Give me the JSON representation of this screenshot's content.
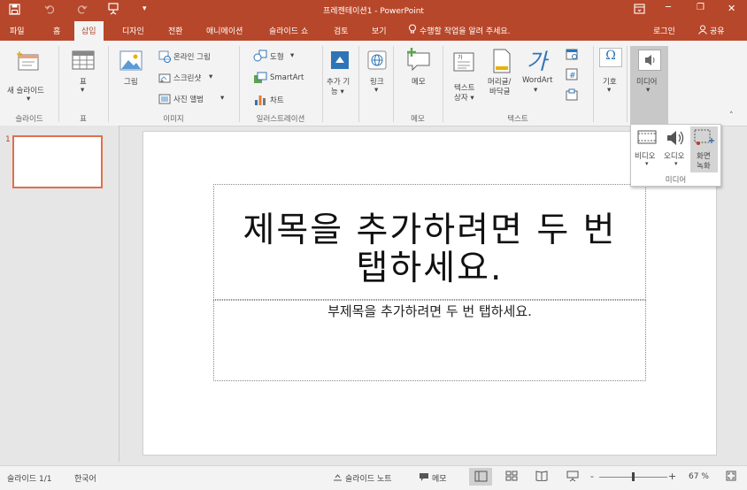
{
  "window": {
    "title": "프레젠테이션1 - PowerPoint",
    "qat": {
      "save_icon": "save-icon",
      "undo_icon": "undo-icon",
      "redo_icon": "redo-icon",
      "start_icon": "slideshow-start-icon",
      "customize": "▾"
    },
    "controls": {
      "ribbon_options": "ribbon-display-icon",
      "minimize": "─",
      "maximize": "❐",
      "close": "✕"
    }
  },
  "tabs": {
    "file": "파일",
    "home": "홈",
    "insert": "삽입",
    "design": "디자인",
    "transitions": "전환",
    "animations": "애니메이션",
    "slideshow": "슬라이드 쇼",
    "review": "검토",
    "view": "보기",
    "tellme": "수행할 작업을 알려 주세요.",
    "signin": "로그인",
    "share": "공유"
  },
  "ribbon": {
    "slides": {
      "new_slide_line1": "새 슬라이드",
      "group": "슬라이드"
    },
    "tables": {
      "table": "표",
      "group": "표"
    },
    "images": {
      "pictures": "그림",
      "online_pictures": "온라인 그림",
      "screenshot": "스크린샷",
      "photo_album": "사진 앨범",
      "group": "이미지"
    },
    "illustrations": {
      "shapes": "도형",
      "smartart": "SmartArt",
      "chart": "차트",
      "group": "일러스트레이션"
    },
    "addins": {
      "line1": "추가 기",
      "line2": "능"
    },
    "links": {
      "link": "링크"
    },
    "comments": {
      "comment": "메모",
      "group": "메모"
    },
    "text": {
      "textbox_line1": "텍스트",
      "textbox_line2": "상자",
      "headerfooter_line1": "머리글/",
      "headerfooter_line2": "바닥글",
      "wordart": "WordArt",
      "group": "텍스트",
      "wordart_glyph": "가"
    },
    "symbols": {
      "symbol": "기호",
      "glyph": "Ω"
    },
    "media": {
      "media": "미디어"
    }
  },
  "thumbnails": {
    "slide_number": "1"
  },
  "slide": {
    "title_placeholder": "제목을 추가하려면 두 번 탭하세요.",
    "subtitle_placeholder": "부제목을 추가하려면 두 번 탭하세요."
  },
  "media_dropdown": {
    "video": "비디오",
    "audio": "오디오",
    "screen_recording_line1": "화면",
    "screen_recording_line2": "녹화",
    "group": "미디어"
  },
  "statusbar": {
    "slide_counter": "슬라이드 1/1",
    "language": "한국어",
    "notes": "슬라이드 노트",
    "comments": "메모",
    "zoom_minus": "-",
    "zoom_plus": "+",
    "zoom_level": "67 %",
    "zoom_fraction": 0.5
  },
  "colors": {
    "accent": "#b7472a",
    "ribbon": "#f3f3f3",
    "selected": "#d0d0d0"
  }
}
